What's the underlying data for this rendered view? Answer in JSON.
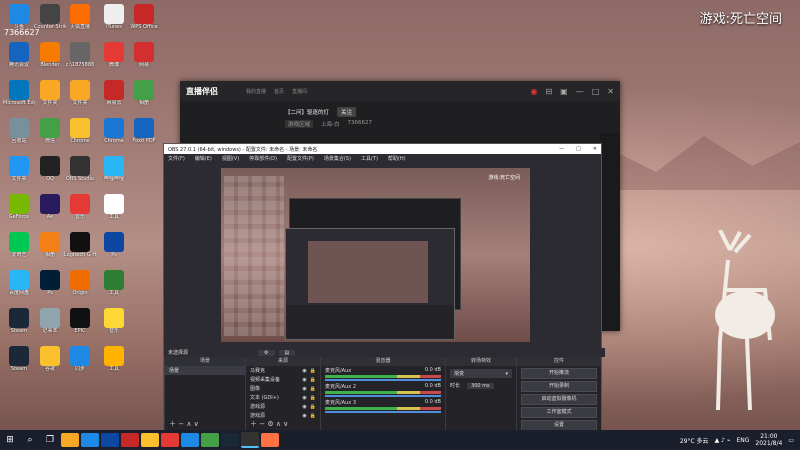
{
  "watermark": "游戏:死亡空间",
  "desktop": {
    "top_label": "7366627",
    "icons": [
      {
        "label": "斗鱼",
        "color": "#1e88e5"
      },
      {
        "label": "Counter-Strike",
        "color": "#444"
      },
      {
        "label": "火狐直播",
        "color": "#ff6d00"
      },
      {
        "label": "iTunes",
        "color": "#eee"
      },
      {
        "label": "WPS Office",
        "color": "#c62828"
      },
      {
        "label": "腾讯会议",
        "color": "#1565c0"
      },
      {
        "label": "Blender",
        "color": "#f57c00"
      },
      {
        "label": "c:\\1875888",
        "color": "#666"
      },
      {
        "label": "微博",
        "color": "#e53935"
      },
      {
        "label": "网易",
        "color": "#d32f2f"
      },
      {
        "label": "Microsoft Edge",
        "color": "#0277bd"
      },
      {
        "label": "文件夹",
        "color": "#f9a825"
      },
      {
        "label": "文件夹",
        "color": "#f9a825"
      },
      {
        "label": "网易云",
        "color": "#c62828"
      },
      {
        "label": "相册",
        "color": "#43a047"
      },
      {
        "label": "回收站",
        "color": "#78909c"
      },
      {
        "label": "微信",
        "color": "#43a047"
      },
      {
        "label": "Chrome",
        "color": "#fbc02d"
      },
      {
        "label": "Chrome",
        "color": "#1976d2"
      },
      {
        "label": "Foxit PDF",
        "color": "#1565c0"
      },
      {
        "label": "文件夹",
        "color": "#2196f3"
      },
      {
        "label": "QQ",
        "color": "#222"
      },
      {
        "label": "OBS Studio",
        "color": "#333"
      },
      {
        "label": "哔哩哔哩",
        "color": "#29b6f6"
      },
      {
        "label": "GeForce",
        "color": "#76b900"
      },
      {
        "label": "Ae",
        "color": "#2a1b5f"
      },
      {
        "label": "音乐",
        "color": "#e53935"
      },
      {
        "label": "工具",
        "color": "#fff"
      },
      {
        "label": "爱奇艺",
        "color": "#00c853"
      },
      {
        "label": "相册",
        "color": "#f57f17"
      },
      {
        "label": "Logitech G HUB",
        "color": "#111"
      },
      {
        "label": "Ps",
        "color": "#0d47a1"
      },
      {
        "label": "百度网盘",
        "color": "#29b6f6"
      },
      {
        "label": "Ps",
        "color": "#001e36"
      },
      {
        "label": "Origin",
        "color": "#ef6c00"
      },
      {
        "label": "工具",
        "color": "#2e7d32"
      },
      {
        "label": "Steam",
        "color": "#1b2838"
      },
      {
        "label": "记事本",
        "color": "#90a4ae"
      },
      {
        "label": "EPIC",
        "color": "#111"
      },
      {
        "label": "音乐",
        "color": "#fdd835"
      },
      {
        "label": "Steam",
        "color": "#1b2838"
      },
      {
        "label": "谷歌",
        "color": "#fbc02d"
      },
      {
        "label": "同步",
        "color": "#1e88e5"
      },
      {
        "label": "工具",
        "color": "#ffb300"
      }
    ]
  },
  "client": {
    "logo": "直播伴侣",
    "tabs": [
      "我的直播",
      "首页",
      "直播间"
    ],
    "room_title": "【二问】驱逐的灯",
    "badge": "关注",
    "room_meta": [
      "游戏区域",
      "上海-白",
      "7366627"
    ],
    "controls": [
      "◉",
      "⊟",
      "▣",
      "—",
      "□",
      "✕"
    ]
  },
  "obs": {
    "title": "OBS 27.0.1 (64-bit, windows) - 配置文件: 未命名 - 场景: 未命名",
    "controls": [
      "—",
      "□",
      "✕"
    ],
    "menu": [
      "文件(F)",
      "编辑(E)",
      "视图(V)",
      "停靠部件(D)",
      "配置文件(P)",
      "场景集合(S)",
      "工具(T)",
      "帮助(H)"
    ],
    "preview_label": "未选择源",
    "docks": {
      "scenes": {
        "header": "场景",
        "items": [
          "场景"
        ]
      },
      "sources": {
        "header": "来源",
        "items": [
          "马赛克",
          "视频采集设备",
          "图像",
          "文本 (GDI+)",
          "游戏源",
          "游戏源"
        ]
      },
      "mixer": {
        "header": "混音器",
        "channels": [
          {
            "name": "麦克风/Aux",
            "db": "0.0 dB"
          },
          {
            "name": "麦克风/Aux 2",
            "db": "0.0 dB"
          },
          {
            "name": "麦克风/Aux 3",
            "db": "0.0 dB"
          }
        ]
      },
      "transitions": {
        "header": "转场特效",
        "type": "渐变",
        "duration_label": "时长",
        "duration_value": "300 ms"
      },
      "controls": {
        "header": "控件",
        "buttons": [
          "开始推流",
          "开始录制",
          "启动虚拟摄像机",
          "工作室模式",
          "设置",
          "退出"
        ]
      }
    }
  },
  "taskbar": {
    "weather": "29°C 多云",
    "lang": "ENG",
    "time": "21:00",
    "date": "2021/8/4"
  },
  "colors": {
    "accent": "#1e88e5",
    "obs_bg": "#2b2b31"
  }
}
